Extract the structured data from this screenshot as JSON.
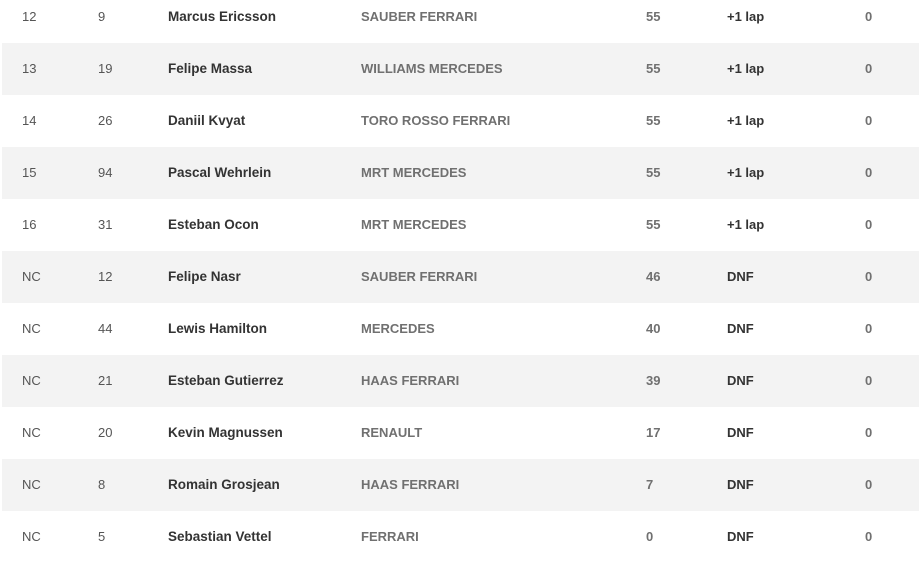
{
  "results": {
    "rows": [
      {
        "pos": "12",
        "number": "9",
        "driver": "Marcus Ericsson",
        "team": "SAUBER FERRARI",
        "laps": "55",
        "time": "+1 lap",
        "points": "0"
      },
      {
        "pos": "13",
        "number": "19",
        "driver": "Felipe Massa",
        "team": "WILLIAMS MERCEDES",
        "laps": "55",
        "time": "+1 lap",
        "points": "0"
      },
      {
        "pos": "14",
        "number": "26",
        "driver": "Daniil Kvyat",
        "team": "TORO ROSSO FERRARI",
        "laps": "55",
        "time": "+1 lap",
        "points": "0"
      },
      {
        "pos": "15",
        "number": "94",
        "driver": "Pascal Wehrlein",
        "team": "MRT MERCEDES",
        "laps": "55",
        "time": "+1 lap",
        "points": "0"
      },
      {
        "pos": "16",
        "number": "31",
        "driver": "Esteban Ocon",
        "team": "MRT MERCEDES",
        "laps": "55",
        "time": "+1 lap",
        "points": "0"
      },
      {
        "pos": "NC",
        "number": "12",
        "driver": "Felipe Nasr",
        "team": "SAUBER FERRARI",
        "laps": "46",
        "time": "DNF",
        "points": "0"
      },
      {
        "pos": "NC",
        "number": "44",
        "driver": "Lewis Hamilton",
        "team": "MERCEDES",
        "laps": "40",
        "time": "DNF",
        "points": "0"
      },
      {
        "pos": "NC",
        "number": "21",
        "driver": "Esteban Gutierrez",
        "team": "HAAS FERRARI",
        "laps": "39",
        "time": "DNF",
        "points": "0"
      },
      {
        "pos": "NC",
        "number": "20",
        "driver": "Kevin Magnussen",
        "team": "RENAULT",
        "laps": "17",
        "time": "DNF",
        "points": "0"
      },
      {
        "pos": "NC",
        "number": "8",
        "driver": "Romain Grosjean",
        "team": "HAAS FERRARI",
        "laps": "7",
        "time": "DNF",
        "points": "0"
      },
      {
        "pos": "NC",
        "number": "5",
        "driver": "Sebastian Vettel",
        "team": "FERRARI",
        "laps": "0",
        "time": "DNF",
        "points": "0"
      }
    ]
  },
  "colors": {
    "row_alt_background": "#f3f3f3",
    "text_dark": "#333333",
    "text_muted": "#707070"
  }
}
